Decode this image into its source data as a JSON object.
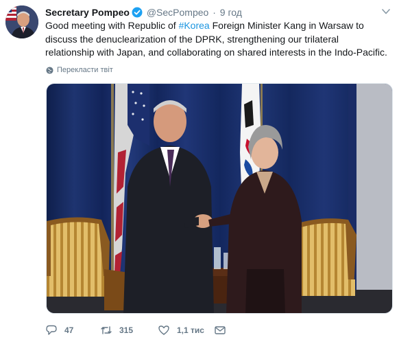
{
  "tweet": {
    "author_name": "Secretary Pompeo",
    "handle": "@SecPompeo",
    "separator": "·",
    "time": "9 год",
    "text_before": "Good meeting with Republic of ",
    "hashtag": "#Korea",
    "text_after": " Foreign Minister Kang in Warsaw to discuss the denuclearization of the DPRK, strengthening our trilateral relationship with Japan, and collaborating on shared interests in the Indo-Pacific.",
    "translate_label": "Перекласти твіт",
    "hashtag_color": "#1b95e0",
    "verified_color": "#1da1f2"
  },
  "actions": {
    "reply_count": "47",
    "retweet_count": "315",
    "like_count": "1,1 тис",
    "reply_icon": "reply-icon",
    "retweet_icon": "retweet-icon",
    "like_icon": "heart-icon",
    "dm_icon": "envelope-icon"
  }
}
